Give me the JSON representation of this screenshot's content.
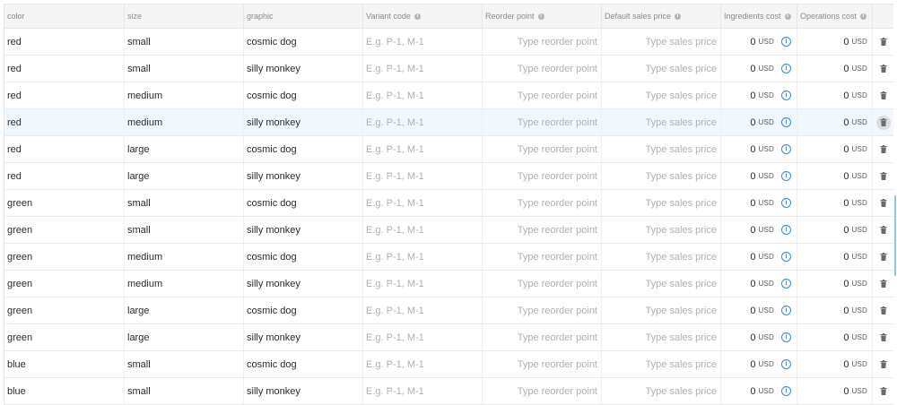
{
  "table": {
    "headers": [
      {
        "key": "color",
        "label": "color",
        "info": false
      },
      {
        "key": "size",
        "label": "size",
        "info": false
      },
      {
        "key": "graphic",
        "label": "graphic",
        "info": false
      },
      {
        "key": "variant_code",
        "label": "Variant code",
        "info": true
      },
      {
        "key": "reorder_point",
        "label": "Reorder point",
        "info": true
      },
      {
        "key": "default_sales_price",
        "label": "Default sales price",
        "info": true
      },
      {
        "key": "ingredients_cost",
        "label": "Ingredients cost",
        "info": true
      },
      {
        "key": "operations_cost",
        "label": "Operations cost",
        "info": true
      }
    ],
    "placeholders": {
      "variant_code": "E.g. P-1, M-1",
      "reorder_point": "Type reorder point",
      "default_sales_price": "Type sales price"
    },
    "currency": "USD",
    "highlighted_row": 3,
    "rows": [
      {
        "color": "red",
        "size": "small",
        "graphic": "cosmic dog",
        "ingredients_cost": "0",
        "operations_cost": "0"
      },
      {
        "color": "red",
        "size": "small",
        "graphic": "silly monkey",
        "ingredients_cost": "0",
        "operations_cost": "0"
      },
      {
        "color": "red",
        "size": "medium",
        "graphic": "cosmic dog",
        "ingredients_cost": "0",
        "operations_cost": "0"
      },
      {
        "color": "red",
        "size": "medium",
        "graphic": "silly monkey",
        "ingredients_cost": "0",
        "operations_cost": "0"
      },
      {
        "color": "red",
        "size": "large",
        "graphic": "cosmic dog",
        "ingredients_cost": "0",
        "operations_cost": "0"
      },
      {
        "color": "red",
        "size": "large",
        "graphic": "silly monkey",
        "ingredients_cost": "0",
        "operations_cost": "0"
      },
      {
        "color": "green",
        "size": "small",
        "graphic": "cosmic dog",
        "ingredients_cost": "0",
        "operations_cost": "0"
      },
      {
        "color": "green",
        "size": "small",
        "graphic": "silly monkey",
        "ingredients_cost": "0",
        "operations_cost": "0"
      },
      {
        "color": "green",
        "size": "medium",
        "graphic": "cosmic dog",
        "ingredients_cost": "0",
        "operations_cost": "0"
      },
      {
        "color": "green",
        "size": "medium",
        "graphic": "silly monkey",
        "ingredients_cost": "0",
        "operations_cost": "0"
      },
      {
        "color": "green",
        "size": "large",
        "graphic": "cosmic dog",
        "ingredients_cost": "0",
        "operations_cost": "0"
      },
      {
        "color": "green",
        "size": "large",
        "graphic": "silly monkey",
        "ingredients_cost": "0",
        "operations_cost": "0"
      },
      {
        "color": "blue",
        "size": "small",
        "graphic": "cosmic dog",
        "ingredients_cost": "0",
        "operations_cost": "0"
      },
      {
        "color": "blue",
        "size": "small",
        "graphic": "silly monkey",
        "ingredients_cost": "0",
        "operations_cost": "0"
      }
    ]
  },
  "icons": {
    "header_info": "info-circle-icon",
    "ingredients_info": "info-circle-icon",
    "delete": "trash-icon"
  },
  "colors": {
    "accent": "#2f8fd8",
    "highlight_row": "#f1f8fd",
    "header_bg": "#f4f5f6"
  }
}
